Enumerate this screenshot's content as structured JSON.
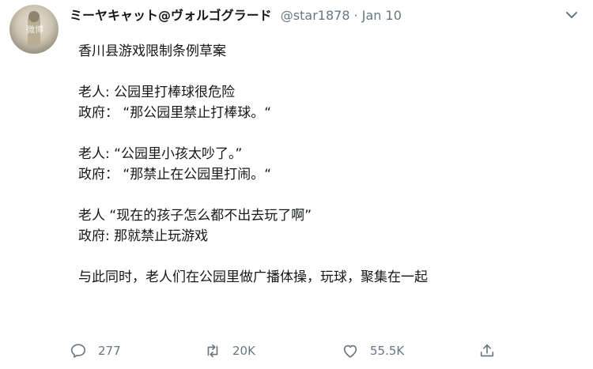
{
  "author": {
    "name": "ミーヤキャット@ヴォルゴグラード",
    "handle": "@star1878",
    "separator": "·",
    "date": "Jan 10",
    "avatar_watermark": "微博"
  },
  "tweet_lines": [
    "香川县游戏限制条例草案",
    "",
    "老人: 公园里打棒球很危险",
    "政府： “那公园里禁止打棒球。“",
    "",
    "老人: “公园里小孩太吵了。”",
    "政府： “那禁止在公园里打闹。“",
    "",
    "老人 “现在的孩子怎么都不出去玩了啊”",
    "政府: 那就禁止玩游戏",
    "",
    "与此同时，老人们在公园里做广播体操，玩球，聚集在一起"
  ],
  "actions": {
    "reply": {
      "icon": "reply-icon",
      "count": "277"
    },
    "retweet": {
      "icon": "retweet-icon",
      "count": "20K"
    },
    "like": {
      "icon": "heart-icon",
      "count": "55.5K"
    },
    "share": {
      "icon": "share-icon"
    }
  },
  "colors": {
    "text": "#14171a",
    "secondary": "#657786",
    "background": "#ffffff"
  }
}
